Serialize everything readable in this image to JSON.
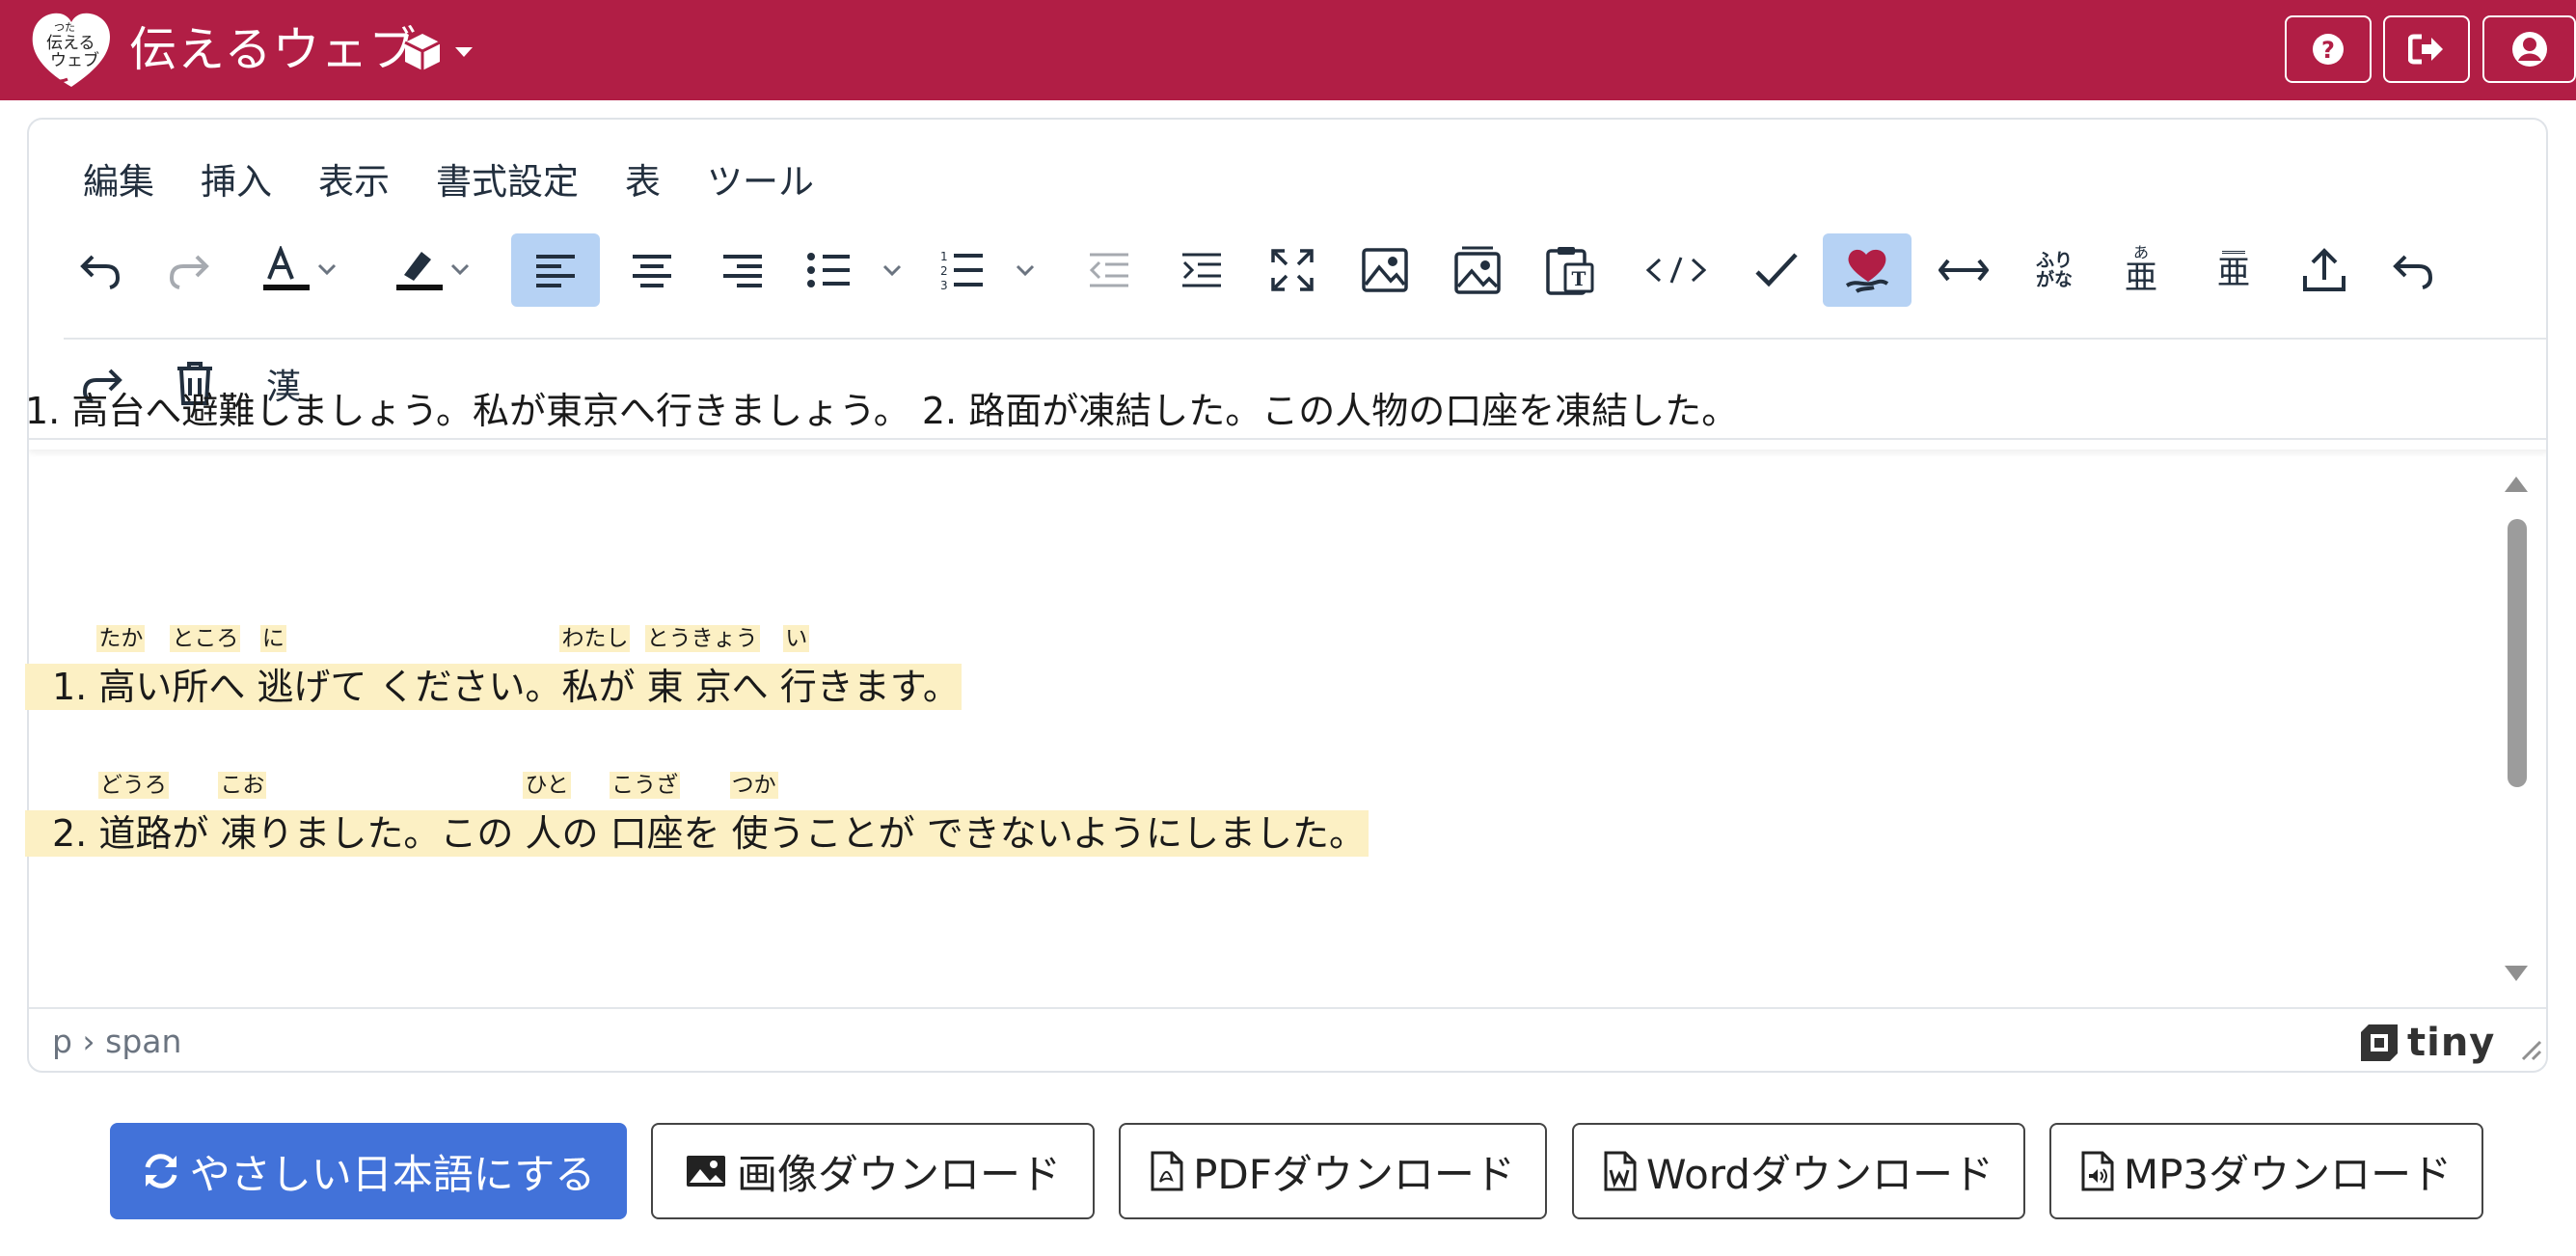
{
  "header": {
    "app_title": "伝えるウェブ",
    "logo_text_lines": [
      "つた",
      "伝える",
      "ウェブ"
    ],
    "colors": {
      "header_bg": "#b11e45",
      "primary_button": "#4272d9",
      "highlight": "#fcf0c4",
      "active_tool": "#b6d2f4"
    },
    "right_buttons": [
      "help-icon",
      "sign-out-icon",
      "user-icon"
    ]
  },
  "menubar": [
    "編集",
    "挿入",
    "表示",
    "書式設定",
    "表",
    "ツール"
  ],
  "toolbar": {
    "row1": [
      "undo-icon",
      "redo-icon",
      "text-color-icon",
      "highlight-color-icon",
      "align-left-icon",
      "align-center-icon",
      "align-right-icon",
      "bullet-list-icon",
      "numbered-list-icon",
      "outdent-icon",
      "indent-icon",
      "fullscreen-icon",
      "image-icon",
      "image-edit-icon",
      "paste-text-icon",
      "code-icon",
      "checkmark-icon",
      "heart-hand-icon",
      "horizontal-arrows-icon",
      "furigana-icon",
      "ruby-above-icon",
      "ruby-below-icon",
      "upload-icon",
      "undo-alt-icon"
    ],
    "row2": [
      "redo-alt-icon",
      "trash-icon",
      "kanji-button"
    ],
    "furigana_label": "ふり がな",
    "ruby_above_small": "あ",
    "ruby_kanji": "亜",
    "kanji_label": "漢"
  },
  "content": {
    "paragraph1": "1. 高台へ避難しましょう。私が東京へ行きましょう。 2. 路面が凍結した。この人物の口座を凍結した。",
    "ruby_line1": [
      {
        "text": "1. ",
        "ruby": ""
      },
      {
        "text": "高",
        "ruby": "たか"
      },
      {
        "text": "い",
        "ruby": ""
      },
      {
        "text": "所",
        "ruby": "ところ"
      },
      {
        "text": "へ ",
        "ruby": ""
      },
      {
        "text": "逃",
        "ruby": "に"
      },
      {
        "text": "げて ください。",
        "ruby": ""
      },
      {
        "text": "私",
        "ruby": "わたし"
      },
      {
        "text": "が ",
        "ruby": ""
      },
      {
        "text": "東 京",
        "ruby": "とうきょう"
      },
      {
        "text": "へ ",
        "ruby": ""
      },
      {
        "text": "行",
        "ruby": "い"
      },
      {
        "text": "きます。",
        "ruby": ""
      }
    ],
    "ruby_line2": [
      {
        "text": "2. ",
        "ruby": ""
      },
      {
        "text": "道路",
        "ruby": "どうろ"
      },
      {
        "text": "が ",
        "ruby": ""
      },
      {
        "text": "凍",
        "ruby": "こお"
      },
      {
        "text": "りました。この ",
        "ruby": ""
      },
      {
        "text": "人",
        "ruby": "ひと"
      },
      {
        "text": "の ",
        "ruby": ""
      },
      {
        "text": "口座",
        "ruby": "こうざ"
      },
      {
        "text": "を ",
        "ruby": ""
      },
      {
        "text": "使",
        "ruby": "つか"
      },
      {
        "text": "うことが できないようにしました。",
        "ruby": ""
      }
    ]
  },
  "statusbar": {
    "path": "p › span",
    "brand": "tiny"
  },
  "buttons": {
    "simplify": "やさしい日本語にする",
    "image_download": "画像ダウンロード",
    "pdf_download": "PDFダウンロード",
    "word_download": "Wordダウンロード",
    "mp3_download": "MP3ダウンロード"
  }
}
